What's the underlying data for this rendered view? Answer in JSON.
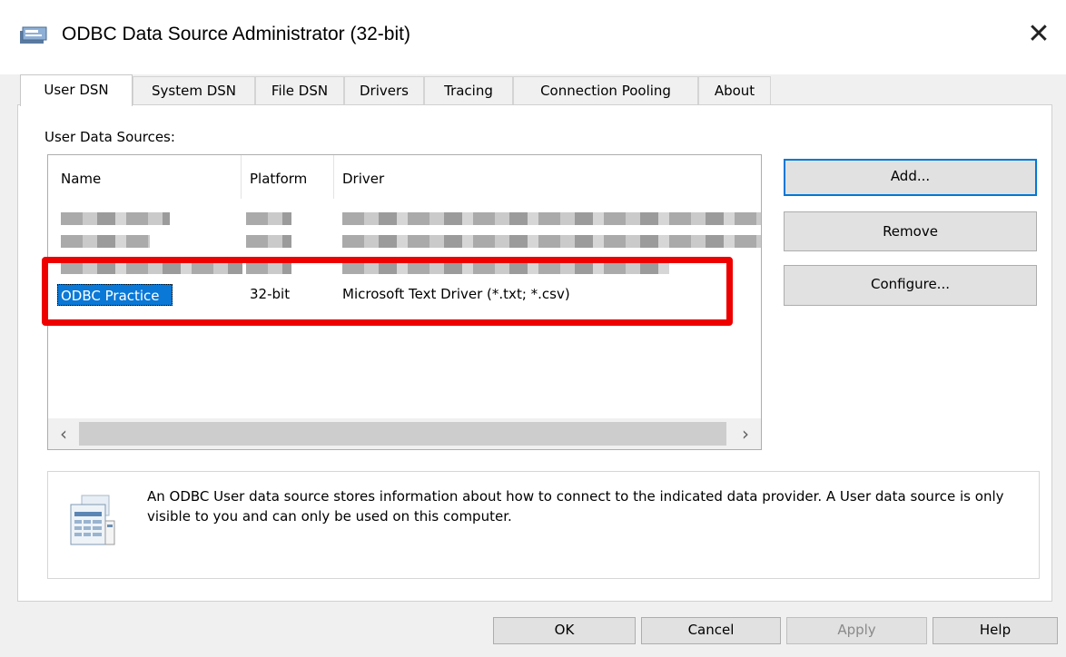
{
  "window": {
    "title": "ODBC Data Source Administrator (32-bit)",
    "app_icon": "odbc-admin-icon",
    "close_icon": "close-icon"
  },
  "tabs": [
    {
      "label": "User DSN",
      "active": true
    },
    {
      "label": "System DSN"
    },
    {
      "label": "File DSN"
    },
    {
      "label": "Drivers"
    },
    {
      "label": "Tracing"
    },
    {
      "label": "Connection Pooling"
    },
    {
      "label": "About"
    }
  ],
  "user_dsn": {
    "section_label": "User Data Sources:",
    "columns": [
      "Name",
      "Platform",
      "Driver"
    ],
    "rows": [
      {
        "name": "ODBC Practice",
        "platform": "32-bit",
        "driver": "Microsoft Text Driver (*.txt; *.csv)",
        "selected": true
      }
    ],
    "buttons": {
      "add": "Add...",
      "remove": "Remove",
      "configure": "Configure..."
    },
    "info_text": "An ODBC User data source stores information about how to connect to the indicated data provider.  A User data source is only visible to you and can only be used on this computer.",
    "info_icon": "data-source-info-icon"
  },
  "footer": {
    "ok": "OK",
    "cancel": "Cancel",
    "apply": "Apply",
    "help": "Help"
  },
  "colors": {
    "selection": "#0a78d7",
    "highlight_box": "#ee0000",
    "default_button_border": "#0078d7"
  }
}
